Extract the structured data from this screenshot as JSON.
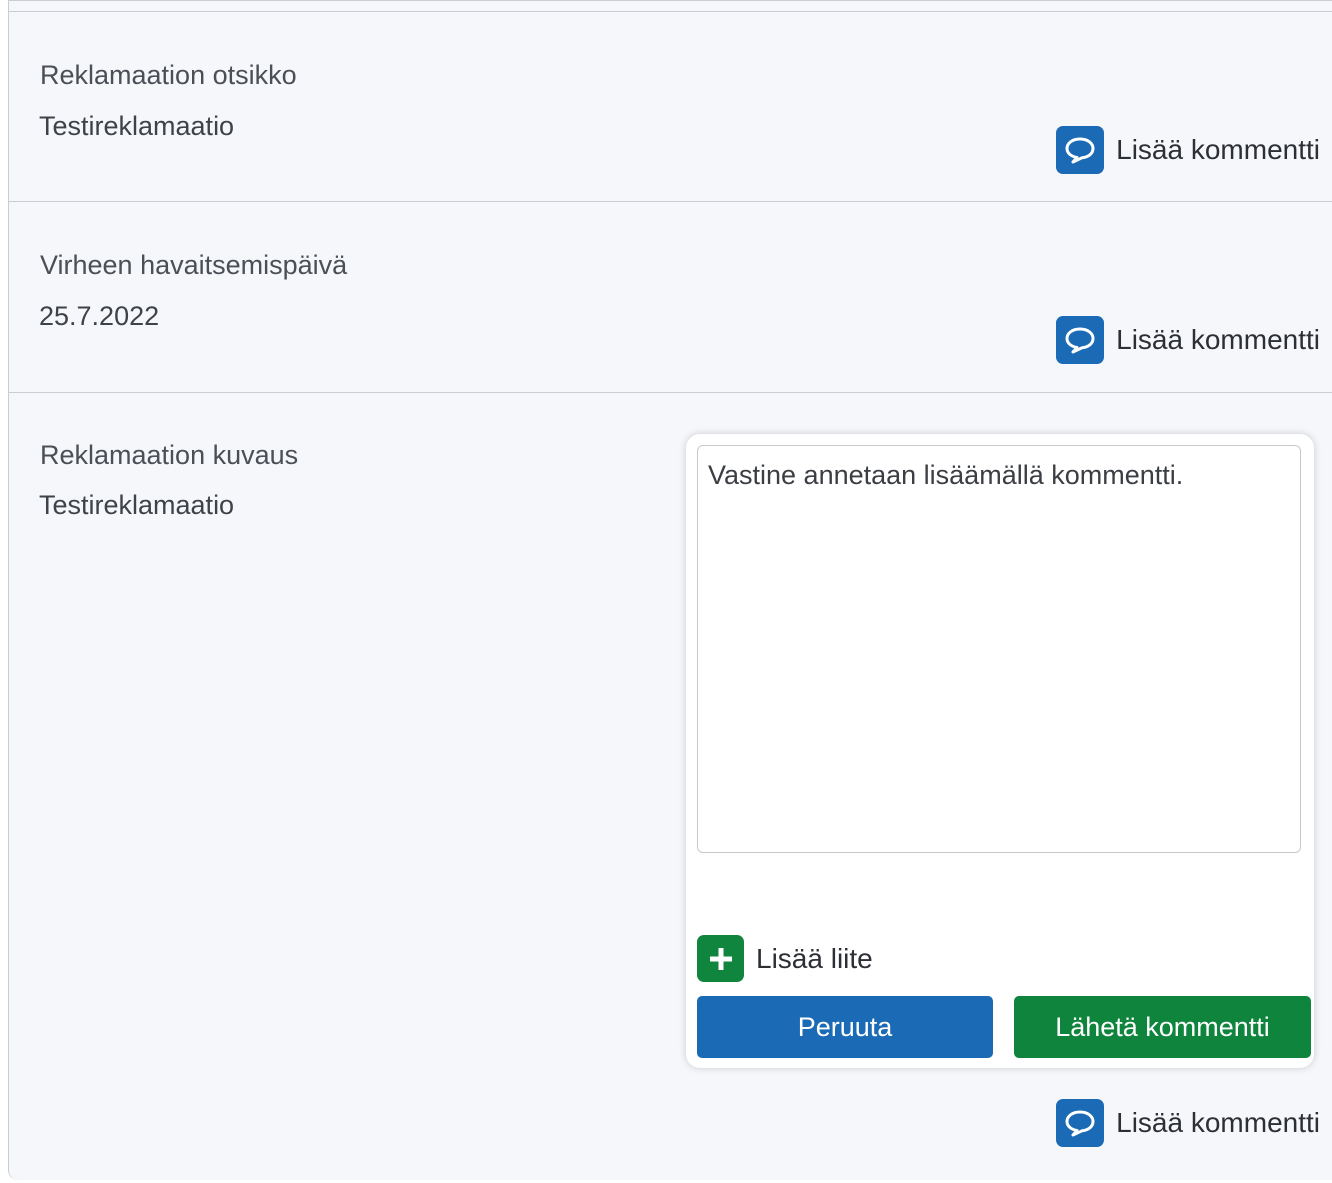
{
  "fields": [
    {
      "label": "Reklamaation otsikko",
      "value": "Testireklamaatio"
    },
    {
      "label": "Virheen havaitsemispäivä",
      "value": "25.7.2022"
    },
    {
      "label": "Reklamaation kuvaus",
      "value": "Testireklamaatio"
    }
  ],
  "add_comment_label": "Lisää kommentti",
  "comment_form": {
    "placeholder": "Vastine annetaan lisäämällä kommentti.",
    "value": "",
    "add_attachment_label": "Lisää liite",
    "cancel_label": "Peruuta",
    "send_label": "Lähetä kommentti"
  },
  "colors": {
    "primary_blue": "#1b6ab5",
    "success_green": "#0f843d",
    "panel_background": "#f6f7fb"
  },
  "icons": {
    "comment": "comment-icon",
    "add": "plus-icon"
  }
}
